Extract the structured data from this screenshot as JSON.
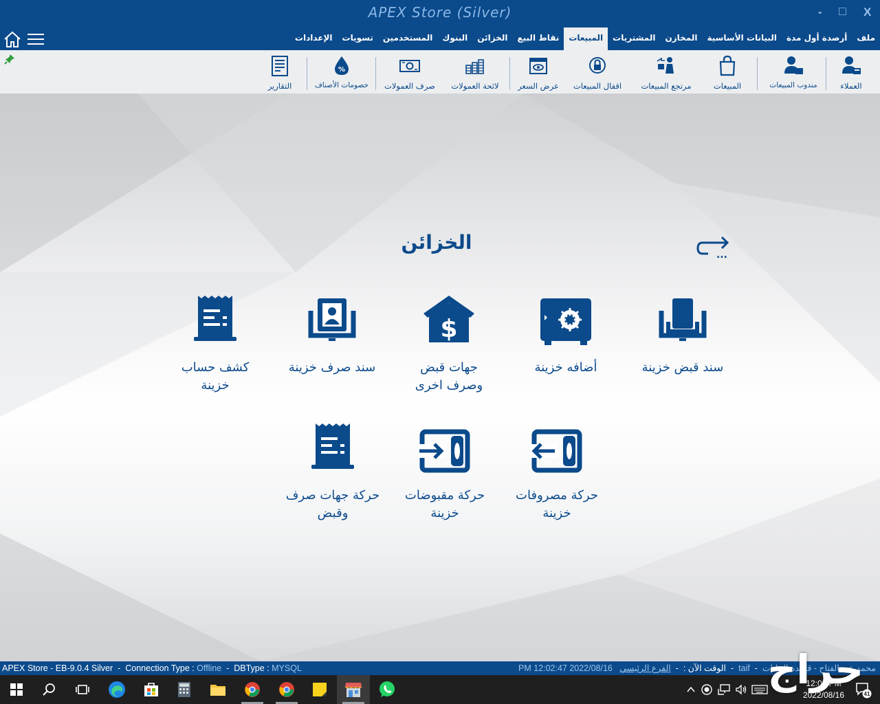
{
  "window": {
    "title": "APEX Store (Silver)",
    "minimize": "-",
    "maximize": "□",
    "close": "X"
  },
  "menu": {
    "tabs": [
      "ملف",
      "أرصدة أول مدة",
      "البيانات الأساسية",
      "المخازن",
      "المشتريات",
      "المبيعات",
      "نقاط البيع",
      "الخزائن",
      "البنوك",
      "المستخدمين",
      "تسويات",
      "الإعدادات"
    ],
    "active_tab": "المبيعات"
  },
  "ribbon": {
    "items": [
      {
        "label": "العملاء",
        "icon": "customer-icon"
      },
      {
        "label": "مندوب المبيعات",
        "icon": "sales-rep-icon"
      },
      {
        "label": "المبيعات",
        "icon": "shopping-bag-icon"
      },
      {
        "label": "مرتجع المبيعات",
        "icon": "sales-return-icon"
      },
      {
        "label": "اقفال المبيعات",
        "icon": "lock-icon"
      },
      {
        "label": "عرض السعر",
        "icon": "quotation-icon"
      },
      {
        "label": "لائحة العمولات",
        "icon": "coins-icon"
      },
      {
        "label": "صرف العمولات",
        "icon": "banknote-icon"
      },
      {
        "label": "خصومات الأصناف",
        "icon": "discount-drop-icon"
      },
      {
        "label": "التقارير",
        "icon": "report-icon"
      }
    ]
  },
  "main": {
    "title": "الخزائن",
    "back_label": "...",
    "tiles": [
      {
        "label": "سند قبض خزينة",
        "icon": "cash-receipt-icon"
      },
      {
        "label": "أضافه خزينة",
        "icon": "safe-icon"
      },
      {
        "label": "جهات قبض وصرف اخرى",
        "icon": "house-dollar-icon"
      },
      {
        "label": "سند صرف خزينة",
        "icon": "cash-payment-icon"
      },
      {
        "label": "كشف حساب خزينة",
        "icon": "statement-receipt-icon"
      },
      {
        "label": "حركة مصروفات خزينة",
        "icon": "expense-movement-icon"
      },
      {
        "label": "حركة مقبوضات خزينة",
        "icon": "income-movement-icon"
      },
      {
        "label": "حركة جهات صرف وقبض",
        "icon": "parties-movement-icon"
      }
    ]
  },
  "status": {
    "app": "APEX Store - EB-9.0.4 Silver",
    "connection_label": "Connection Type :",
    "connection_value": "Offline",
    "db_label": "DBType :",
    "db_value": "MYSQL",
    "time_value": "PM 12:02:47 2022/08/16",
    "time_label": "الوقت الآن :",
    "branch": "الفرع الرئيسي",
    "city": "taif",
    "user": "محمد عبد الفتاح - قاعدة البيانات"
  },
  "taskbar": {
    "clock_time": "12:02 PM",
    "clock_date": "2022/08/16",
    "notifications": "41"
  },
  "watermark": "حراج"
}
